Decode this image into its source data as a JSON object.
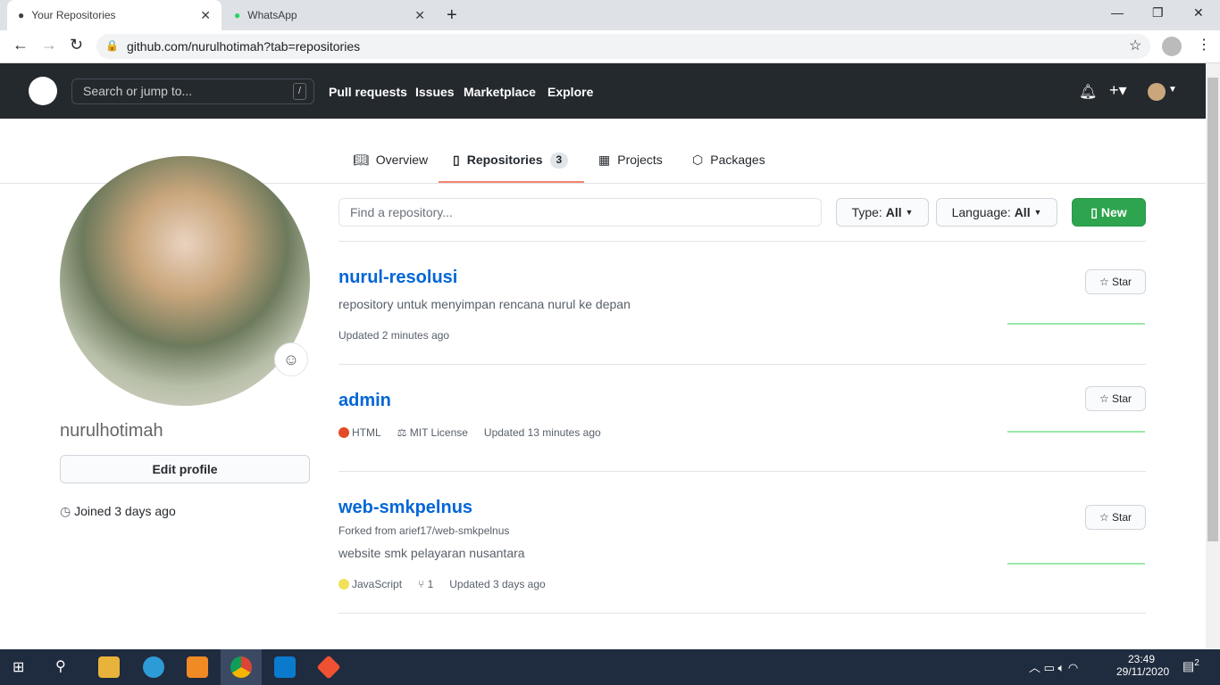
{
  "browser": {
    "tabs": [
      {
        "title": "Your Repositories"
      },
      {
        "title": "WhatsApp"
      }
    ],
    "url": "github.com/nurulhotimah?tab=repositories"
  },
  "header": {
    "search_placeholder": "Search or jump to...",
    "slash": "/",
    "nav": [
      "Pull requests",
      "Issues",
      "Marketplace",
      "Explore"
    ]
  },
  "profile_tabs": [
    {
      "label": "Overview"
    },
    {
      "label": "Repositories",
      "count": "3"
    },
    {
      "label": "Projects"
    },
    {
      "label": "Packages"
    }
  ],
  "profile": {
    "username": "nurulhotimah",
    "edit": "Edit profile",
    "joined": "Joined 3 days ago"
  },
  "filters": {
    "find_placeholder": "Find a repository...",
    "type": "Type:",
    "type_val": "All",
    "lang": "Language:",
    "lang_val": "All",
    "new": "New"
  },
  "repos": [
    {
      "name": "nurul-resolusi",
      "desc": "repository untuk menyimpan rencana nurul ke depan",
      "updated": "Updated 2 minutes ago",
      "star": "Star"
    },
    {
      "name": "admin",
      "lang": "HTML",
      "lang_color": "#e34c26",
      "license": "MIT License",
      "updated": "Updated 13 minutes ago",
      "star": "Star"
    },
    {
      "name": "web-smkpelnus",
      "forked": "Forked from arief17/web-smkpelnus",
      "desc": "website smk pelayaran nusantara",
      "lang": "JavaScript",
      "lang_color": "#f1e05a",
      "forks": "1",
      "updated": "Updated 3 days ago",
      "star": "Star"
    }
  ],
  "taskbar": {
    "time": "23:49",
    "date": "29/11/2020",
    "notifications": "2"
  }
}
